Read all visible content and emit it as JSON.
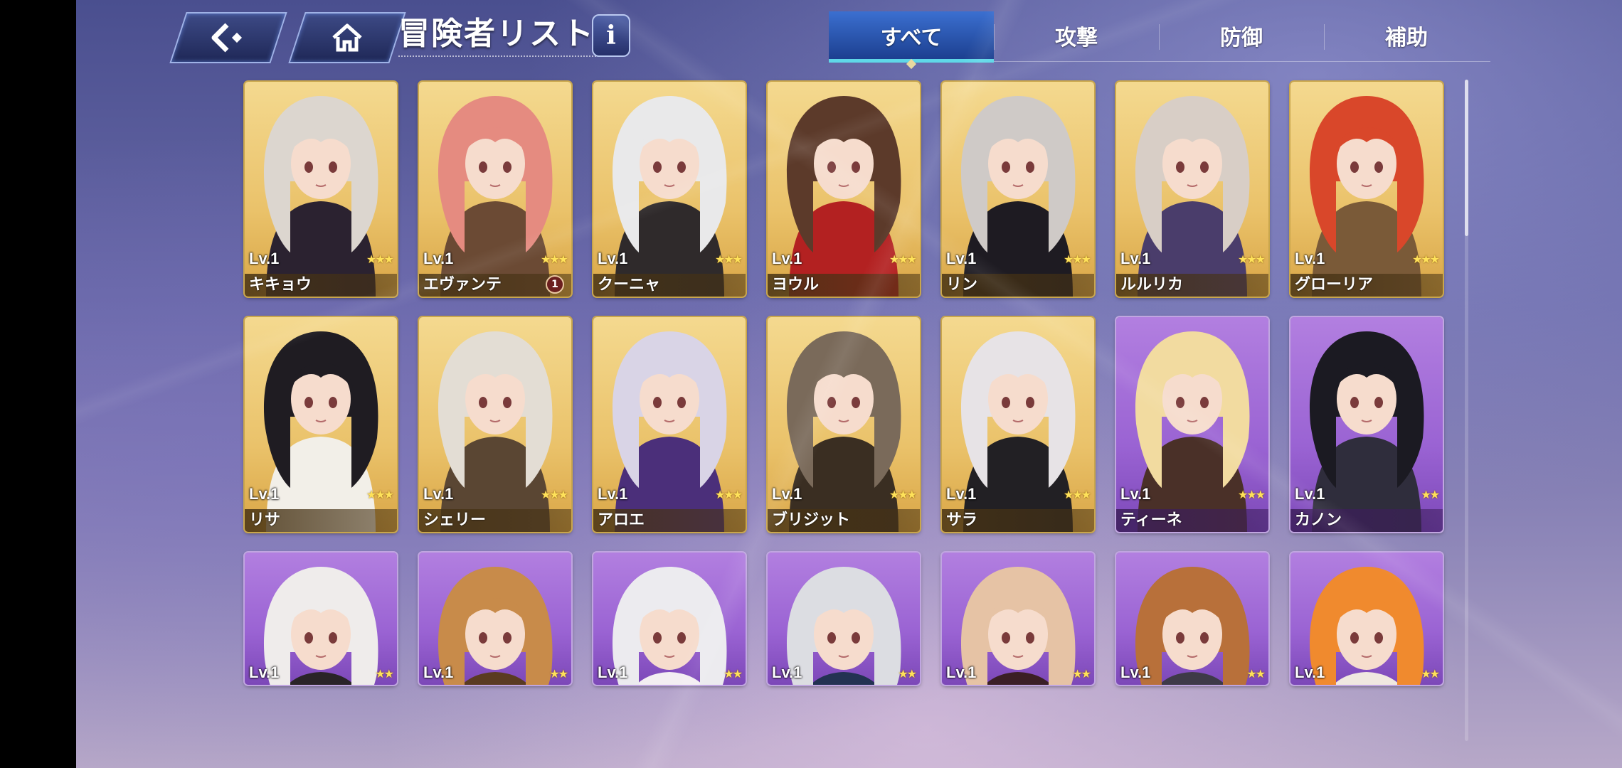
{
  "header": {
    "back_icon": "back-arrow-icon",
    "home_icon": "home-icon",
    "title": "冒険者リスト",
    "info_label": "i"
  },
  "tabs": [
    {
      "label": "すべて",
      "active": true
    },
    {
      "label": "攻撃",
      "active": false
    },
    {
      "label": "防御",
      "active": false
    },
    {
      "label": "補助",
      "active": false
    }
  ],
  "cards": [
    {
      "name": "キキョウ",
      "level": "Lv.1",
      "stars": 3,
      "rarity": "gold",
      "hair": "#dcd6cf",
      "accent": "#2b2230"
    },
    {
      "name": "エヴァンテ",
      "level": "Lv.1",
      "stars": 3,
      "rarity": "gold",
      "hair": "#e58b80",
      "accent": "#6b4a34",
      "badge": "1"
    },
    {
      "name": "クーニャ",
      "level": "Lv.1",
      "stars": 3,
      "rarity": "gold",
      "hair": "#e9e9ea",
      "accent": "#2f2a2b"
    },
    {
      "name": "ヨウル",
      "level": "Lv.1",
      "stars": 3,
      "rarity": "gold",
      "hair": "#5c3a2a",
      "accent": "#b32121"
    },
    {
      "name": "リン",
      "level": "Lv.1",
      "stars": 3,
      "rarity": "gold",
      "hair": "#cfcac7",
      "accent": "#1e1b22"
    },
    {
      "name": "ルルリカ",
      "level": "Lv.1",
      "stars": 3,
      "rarity": "gold",
      "hair": "#d8cec6",
      "accent": "#4a3d6b"
    },
    {
      "name": "グローリア",
      "level": "Lv.1",
      "stars": 3,
      "rarity": "gold",
      "hair": "#d9472a",
      "accent": "#7a5a38"
    },
    {
      "name": "リサ",
      "level": "Lv.1",
      "stars": 3,
      "rarity": "gold",
      "hair": "#1f1c22",
      "accent": "#f2efe8"
    },
    {
      "name": "シェリー",
      "level": "Lv.1",
      "stars": 3,
      "rarity": "gold",
      "hair": "#e3ddd4",
      "accent": "#5a4633"
    },
    {
      "name": "アロエ",
      "level": "Lv.1",
      "stars": 3,
      "rarity": "gold",
      "hair": "#d9d4e6",
      "accent": "#4b2f7a"
    },
    {
      "name": "ブリジット",
      "level": "Lv.1",
      "stars": 3,
      "rarity": "gold",
      "hair": "#7a6a5a",
      "accent": "#3a2e22"
    },
    {
      "name": "サラ",
      "level": "Lv.1",
      "stars": 3,
      "rarity": "gold",
      "hair": "#e7e3e6",
      "accent": "#222024"
    },
    {
      "name": "ティーネ",
      "level": "Lv.1",
      "stars": 3,
      "rarity": "purple",
      "hair": "#f2dba0",
      "accent": "#4a3028"
    },
    {
      "name": "カノン",
      "level": "Lv.1",
      "stars": 2,
      "rarity": "purple",
      "hair": "#1b1a22",
      "accent": "#2f2d3c"
    },
    {
      "name": "",
      "level": "Lv.1",
      "stars": 2,
      "rarity": "purple",
      "hair": "#efeceb",
      "accent": "#2a2428"
    },
    {
      "name": "",
      "level": "Lv.1",
      "stars": 2,
      "rarity": "purple",
      "hair": "#c88b4a",
      "accent": "#5a3b22"
    },
    {
      "name": "",
      "level": "Lv.1",
      "stars": 2,
      "rarity": "purple",
      "hair": "#ecebef",
      "accent": "#f3eef2"
    },
    {
      "name": "",
      "level": "Lv.1",
      "stars": 2,
      "rarity": "purple",
      "hair": "#dcdde2",
      "accent": "#233252"
    },
    {
      "name": "",
      "level": "Lv.1",
      "stars": 2,
      "rarity": "purple",
      "hair": "#e6c3a5",
      "accent": "#3b1f26"
    },
    {
      "name": "",
      "level": "Lv.1",
      "stars": 2,
      "rarity": "purple",
      "hair": "#b8703a",
      "accent": "#3e3a48"
    },
    {
      "name": "",
      "level": "Lv.1",
      "stars": 2,
      "rarity": "purple",
      "hair": "#f08a2e",
      "accent": "#f0e8e0"
    }
  ]
}
